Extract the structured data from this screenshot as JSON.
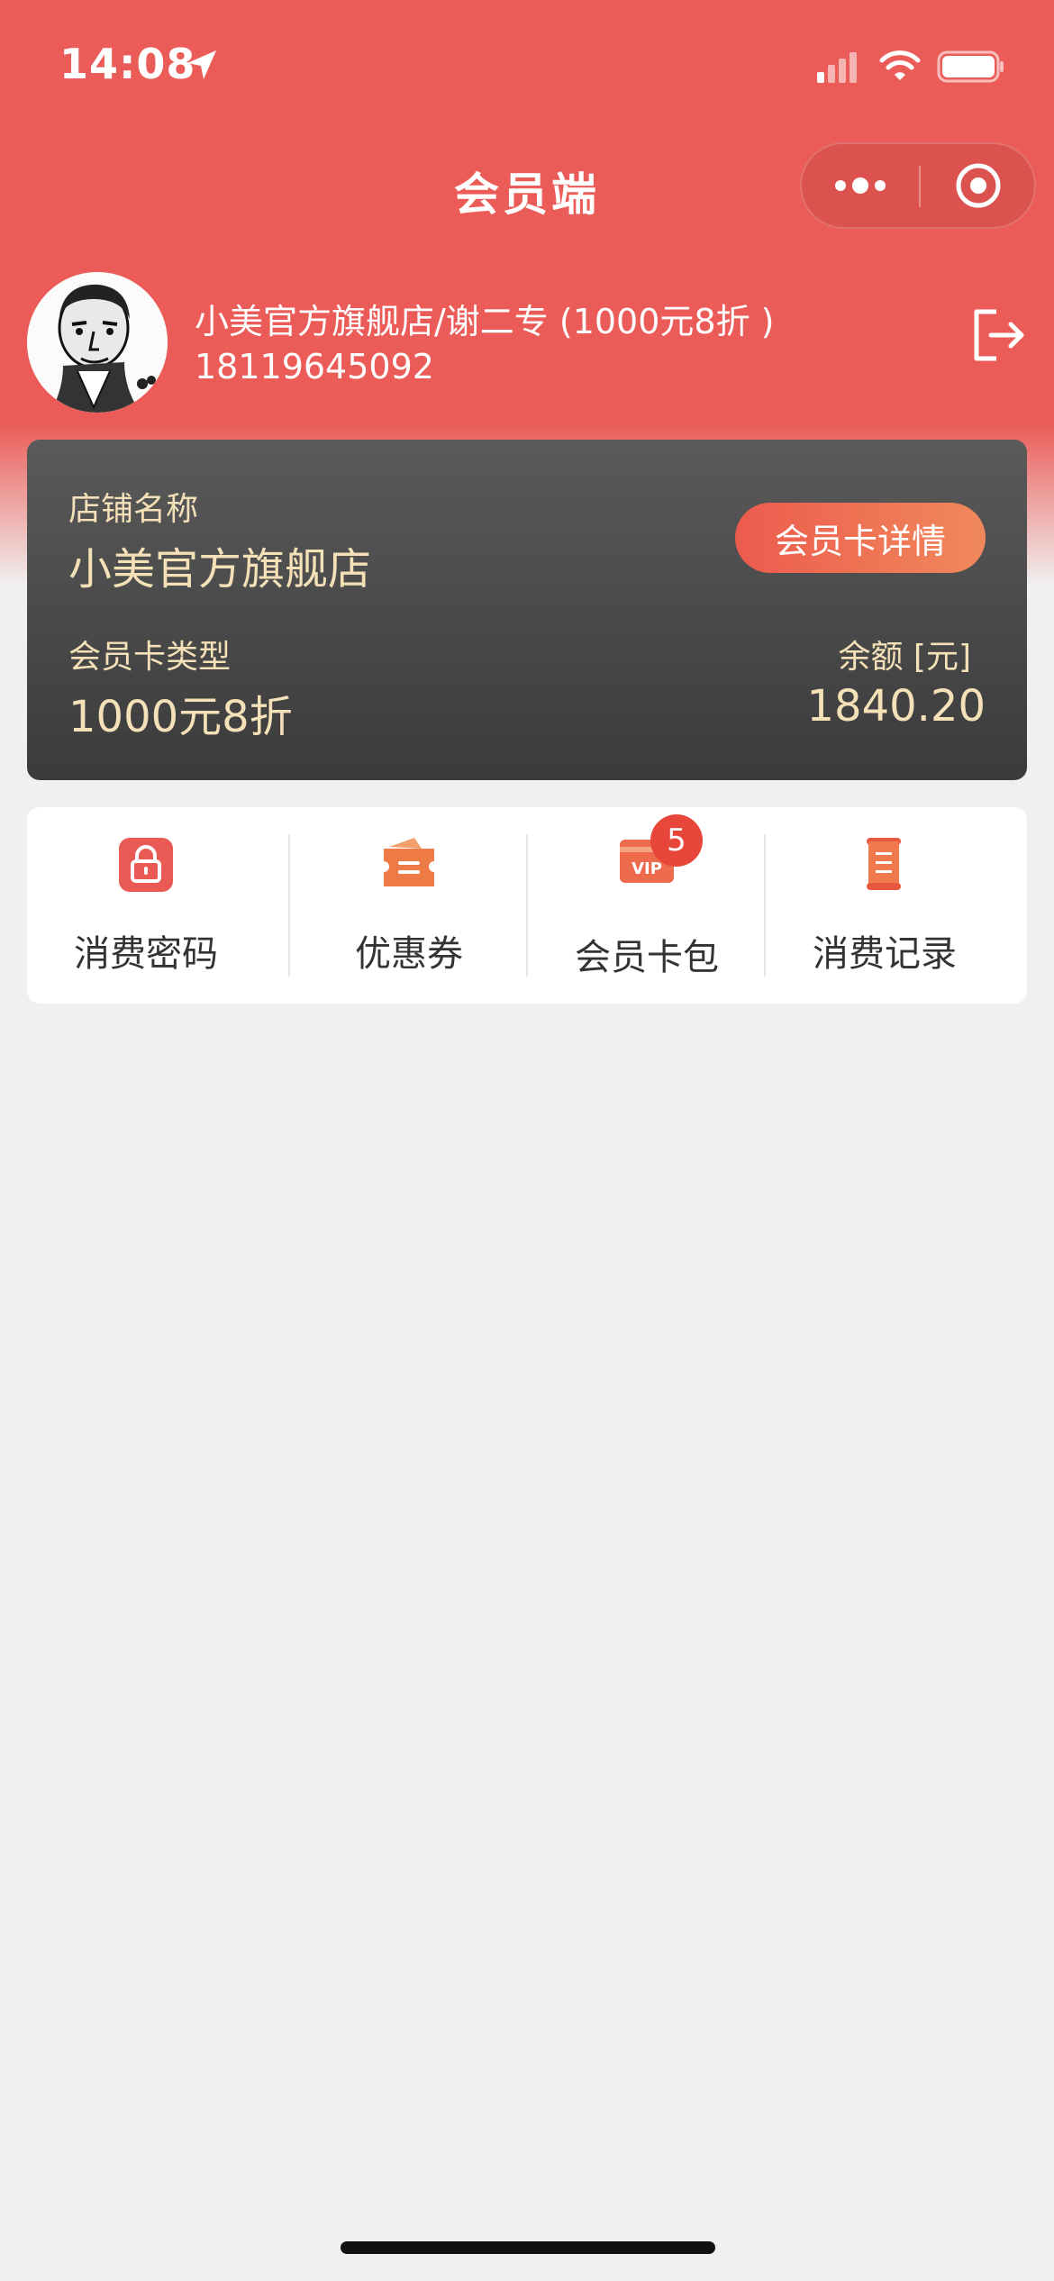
{
  "status_bar": {
    "time": "14:08"
  },
  "nav": {
    "title": "会员端"
  },
  "user": {
    "name": "小美官方旗舰店/谢二专 (1000元8折 )",
    "phone": "18119645092"
  },
  "card": {
    "store_label": "店铺名称",
    "store_name": "小美官方旗舰店",
    "detail_button": "会员卡详情",
    "type_label": "会员卡类型",
    "type_value": "1000元8折",
    "balance_label": "余额 [元]",
    "balance_value": "1840.20"
  },
  "menu": {
    "items": [
      {
        "label": "消费密码",
        "icon": "lock-icon"
      },
      {
        "label": "优惠券",
        "icon": "coupon-icon"
      },
      {
        "label": "会员卡包",
        "icon": "vip-card-icon"
      },
      {
        "label": "消费记录",
        "icon": "record-icon"
      }
    ],
    "badge_count": "5"
  },
  "colors": {
    "header": "#eb5c58",
    "card_text": "#f5e1b8",
    "accent": "#ec5b4d"
  }
}
